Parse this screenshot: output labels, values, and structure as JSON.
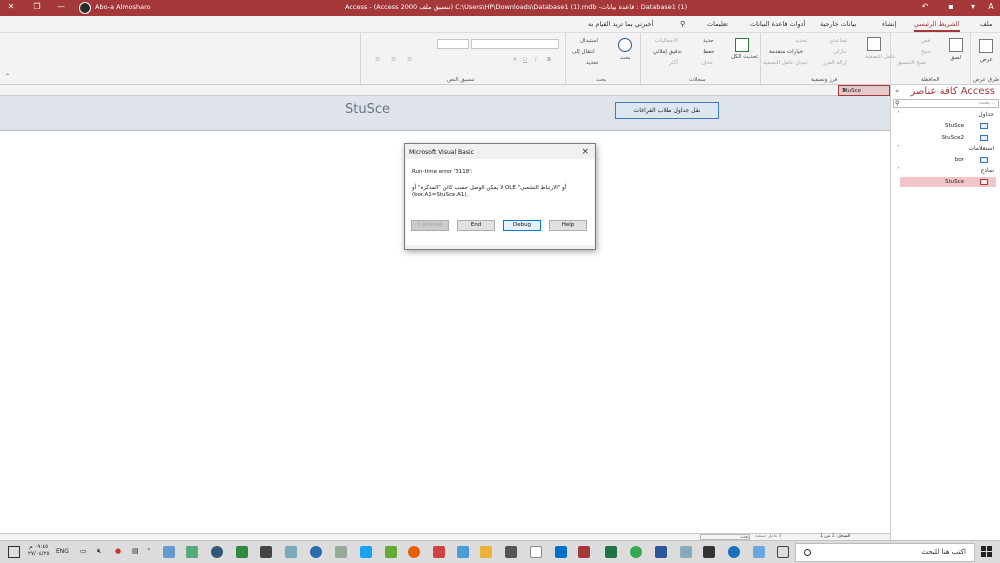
{
  "title_bar": {
    "user_name": "Abo-a Almosharo",
    "document_title": "Access  -  (Access 2000 تنسيق ملف) C:\\Users\\HP\\Downloads\\Database1 (1).mdb -قاعدة بيانات : Database1 (1)"
  },
  "menu_tabs": [
    "ملف",
    "الشريط الرئيسي",
    "إنشاء",
    "بيانات خارجية",
    "أدوات قاعدة البيانات",
    "تعليمات",
    "أخبرني بما تريد القيام به"
  ],
  "ribbon": {
    "views": {
      "label": "طرق عرض",
      "button": "عرض"
    },
    "clipboard": {
      "label": "الحافظة",
      "paste": "لصق",
      "cut": "قص",
      "copy": "نسخ",
      "format_painter": "نسخ التنسيق"
    },
    "sort_filter": {
      "label": "فرز وتصفية",
      "filter": "عامل التصفية",
      "ascending": "تصاعدي",
      "descending": "تنازلي",
      "remove_sort": "إزالة الفرز",
      "selection": "تحديد",
      "advanced": "خيارات متقدمة",
      "toggle_filter": "تبديل عامل التصفية"
    },
    "records": {
      "label": "سجلات",
      "refresh_all": "تحديث الكل",
      "new": "جديد",
      "save": "حفظ",
      "delete": "حذف",
      "totals": "الإجماليات",
      "spelling": "تدقيق إملائي",
      "more": "أكثر"
    },
    "find": {
      "label": "بحث",
      "find": "بحث",
      "replace": "استبدال",
      "go_to": "انتقال إلى",
      "select": "تحديد"
    },
    "text_formatting": {
      "label": "تنسيق النص",
      "bold": "B",
      "italic": "I",
      "underline": "U",
      "font_color": "A"
    }
  },
  "document": {
    "tab_label": "StuSce",
    "form_title": "StuSce",
    "form_button_label": "نقل جداول طلاب الفراغات"
  },
  "nav_pane": {
    "title": "كافة عناصر Access",
    "search_placeholder": "بحث...",
    "sections": [
      {
        "label": "جداول",
        "items": [
          "StuSce",
          "StuSce2"
        ]
      },
      {
        "label": "استعلامات",
        "items": [
          "bor"
        ]
      },
      {
        "label": "نماذج",
        "items": [
          "StuSce"
        ]
      }
    ]
  },
  "dialog": {
    "title": "Microsoft Visual Basic",
    "error_line": "Run-time error '3118':",
    "message_line1": "لا يمكن الوصل حسب كائن \"المذكرة\" أو OLE \"أو \"الارتباط التشعبي",
    "message_line2": "(bor.A1=StuSce.A1).",
    "buttons": {
      "continue": "Continue",
      "end": "End",
      "debug": "Debug",
      "help": "Help"
    }
  },
  "status_bar": {
    "search": "بحث",
    "filter": "لا عامل تصفية",
    "record": "السجل: 1 من 1"
  },
  "taskbar": {
    "search_placeholder": "اكتب هنا للبحث",
    "language": "ENG",
    "time": "٠٩:٤٥ م",
    "date": "٢٧/٠٤/٢٥"
  },
  "colors": {
    "access_accent": "#a4373a",
    "taskbar_bg": "#dcdcdc",
    "ribbon_bg": "#f3f3f3",
    "form_header_bg": "#dfe3ea"
  }
}
